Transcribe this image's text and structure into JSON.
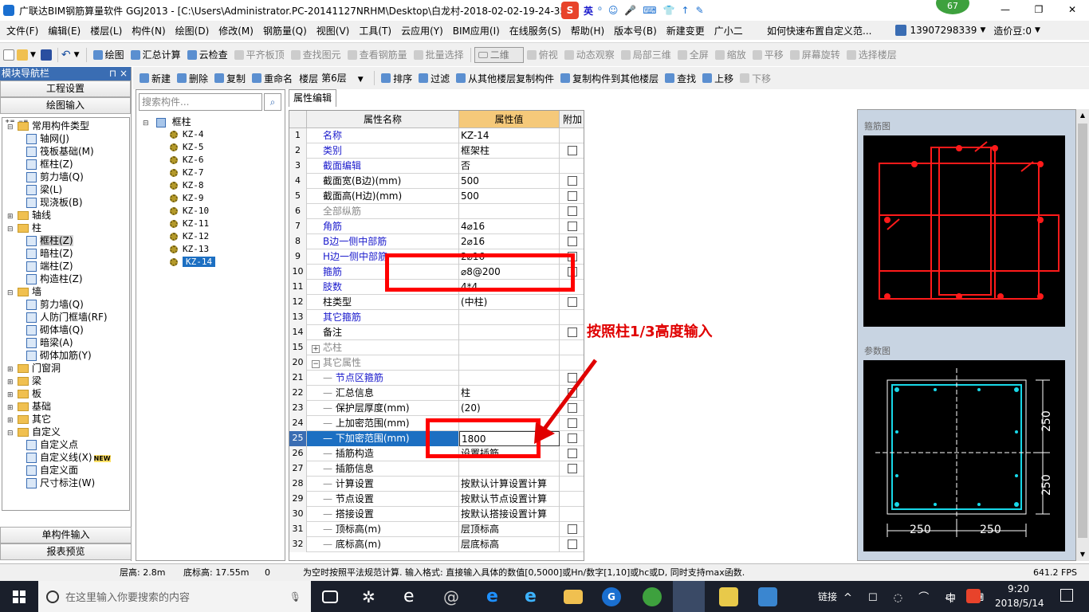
{
  "title": {
    "app": "广联达BIM钢筋算量软件 GGJ2013 - [C:\\Users\\Administrator.PC-20141127NRHM\\Desktop\\白龙村-2018-02-02-19-24-35",
    "ime": "英",
    "badge": "67",
    "controls": [
      "—",
      "❐",
      "✕"
    ]
  },
  "menu": {
    "items": [
      "文件(F)",
      "编辑(E)",
      "楼层(L)",
      "构件(N)",
      "绘图(D)",
      "修改(M)",
      "钢筋量(Q)",
      "视图(V)",
      "工具(T)",
      "云应用(Y)",
      "BIM应用(I)",
      "在线服务(S)",
      "帮助(H)",
      "版本号(B)",
      "新建变更",
      "广小二"
    ],
    "link": "如何快速布置自定义范...",
    "phone": "13907298339",
    "price": "造价豆:0"
  },
  "toolbar1": {
    "items": [
      "绘图",
      "汇总计算",
      "云检查",
      "平齐板顶",
      "查找图元",
      "查看钢筋量",
      "批量选择"
    ],
    "view_select": "二维",
    "items2": [
      "俯视",
      "动态观察",
      "局部三维",
      "全屏",
      "缩放",
      "平移",
      "屏幕旋转",
      "选择楼层"
    ]
  },
  "toolbar2": {
    "items": [
      "新建",
      "删除",
      "复制",
      "重命名"
    ],
    "floor_label": "楼层",
    "floor_value": "第6层",
    "items2": [
      "排序",
      "过滤",
      "从其他楼层复制构件",
      "复制构件到其他楼层",
      "查找",
      "上移",
      "下移"
    ]
  },
  "nav": {
    "title": "模块导航栏",
    "pin": "⊓ ×",
    "tabs": [
      "工程设置",
      "绘图输入"
    ],
    "bottom": [
      "单构件输入",
      "报表预览"
    ],
    "tree": [
      {
        "level": 0,
        "label": "常用构件类型",
        "type": "folder",
        "exp": "⊟"
      },
      {
        "level": 1,
        "label": "轴网(J)",
        "type": "leaf"
      },
      {
        "level": 1,
        "label": "筏板基础(M)",
        "type": "leaf"
      },
      {
        "level": 1,
        "label": "框柱(Z)",
        "type": "leaf"
      },
      {
        "level": 1,
        "label": "剪力墙(Q)",
        "type": "leaf"
      },
      {
        "level": 1,
        "label": "梁(L)",
        "type": "leaf"
      },
      {
        "level": 1,
        "label": "现浇板(B)",
        "type": "leaf"
      },
      {
        "level": 0,
        "label": "轴线",
        "type": "folder",
        "exp": "⊞"
      },
      {
        "level": 0,
        "label": "柱",
        "type": "folder",
        "exp": "⊟"
      },
      {
        "level": 1,
        "label": "框柱(Z)",
        "type": "leaf",
        "sel": true
      },
      {
        "level": 1,
        "label": "暗柱(Z)",
        "type": "leaf"
      },
      {
        "level": 1,
        "label": "端柱(Z)",
        "type": "leaf"
      },
      {
        "level": 1,
        "label": "构造柱(Z)",
        "type": "leaf"
      },
      {
        "level": 0,
        "label": "墙",
        "type": "folder",
        "exp": "⊟"
      },
      {
        "level": 1,
        "label": "剪力墙(Q)",
        "type": "leaf"
      },
      {
        "level": 1,
        "label": "人防门框墙(RF)",
        "type": "leaf"
      },
      {
        "level": 1,
        "label": "砌体墙(Q)",
        "type": "leaf"
      },
      {
        "level": 1,
        "label": "暗梁(A)",
        "type": "leaf"
      },
      {
        "level": 1,
        "label": "砌体加筋(Y)",
        "type": "leaf"
      },
      {
        "level": 0,
        "label": "门窗洞",
        "type": "folder",
        "exp": "⊞"
      },
      {
        "level": 0,
        "label": "梁",
        "type": "folder",
        "exp": "⊞"
      },
      {
        "level": 0,
        "label": "板",
        "type": "folder",
        "exp": "⊞"
      },
      {
        "level": 0,
        "label": "基础",
        "type": "folder",
        "exp": "⊞"
      },
      {
        "level": 0,
        "label": "其它",
        "type": "folder",
        "exp": "⊞"
      },
      {
        "level": 0,
        "label": "自定义",
        "type": "folder",
        "exp": "⊟"
      },
      {
        "level": 1,
        "label": "自定义点",
        "type": "leaf"
      },
      {
        "level": 1,
        "label": "自定义线(X)",
        "type": "leaf",
        "badge": "NEW"
      },
      {
        "level": 1,
        "label": "自定义面",
        "type": "leaf"
      },
      {
        "level": 1,
        "label": "尺寸标注(W)",
        "type": "leaf"
      }
    ]
  },
  "components": {
    "search_placeholder": "搜索构件...",
    "root": "框柱",
    "items": [
      "KZ-4",
      "KZ-5",
      "KZ-6",
      "KZ-7",
      "KZ-8",
      "KZ-9",
      "KZ-10",
      "KZ-11",
      "KZ-12",
      "KZ-13",
      "KZ-14"
    ],
    "selected": "KZ-14"
  },
  "props": {
    "tab": "属性编辑",
    "headers": [
      "属性名称",
      "属性值",
      "附加"
    ],
    "rows": [
      {
        "n": "1",
        "name": "名称",
        "value": "KZ-14",
        "cb": false,
        "style": "blue"
      },
      {
        "n": "2",
        "name": "类别",
        "value": "框架柱",
        "cb": true,
        "style": "blue"
      },
      {
        "n": "3",
        "name": "截面编辑",
        "value": "否",
        "cb": false,
        "style": "blue"
      },
      {
        "n": "4",
        "name": "截面宽(B边)(mm)",
        "value": "500",
        "cb": true,
        "style": ""
      },
      {
        "n": "5",
        "name": "截面高(H边)(mm)",
        "value": "500",
        "cb": true,
        "style": ""
      },
      {
        "n": "6",
        "name": "全部纵筋",
        "value": "",
        "cb": true,
        "style": "grey"
      },
      {
        "n": "7",
        "name": "角筋",
        "value": "4⌀16",
        "cb": true,
        "style": "blue"
      },
      {
        "n": "8",
        "name": "B边一侧中部筋",
        "value": "2⌀16",
        "cb": true,
        "style": "blue"
      },
      {
        "n": "9",
        "name": "H边一侧中部筋",
        "value": "2⌀16",
        "cb": true,
        "style": "blue"
      },
      {
        "n": "10",
        "name": "箍筋",
        "value": "⌀8@200",
        "cb": true,
        "style": "blue"
      },
      {
        "n": "11",
        "name": "肢数",
        "value": "4*4",
        "cb": false,
        "style": "blue"
      },
      {
        "n": "12",
        "name": "柱类型",
        "value": "(中柱)",
        "cb": true,
        "style": ""
      },
      {
        "n": "13",
        "name": "其它箍筋",
        "value": "",
        "cb": false,
        "style": "blue"
      },
      {
        "n": "14",
        "name": "备注",
        "value": "",
        "cb": true,
        "style": ""
      },
      {
        "n": "15",
        "name": "芯柱",
        "value": "",
        "cb": false,
        "style": "grey",
        "exp": "+"
      },
      {
        "n": "20",
        "name": "其它属性",
        "value": "",
        "cb": false,
        "style": "grey",
        "exp": "−"
      },
      {
        "n": "21",
        "name": "节点区箍筋",
        "value": "",
        "cb": true,
        "style": "blue",
        "child": true
      },
      {
        "n": "22",
        "name": "汇总信息",
        "value": "柱",
        "cb": true,
        "style": "",
        "child": true
      },
      {
        "n": "23",
        "name": "保护层厚度(mm)",
        "value": "(20)",
        "cb": true,
        "style": "",
        "child": true
      },
      {
        "n": "24",
        "name": "上加密范围(mm)",
        "value": "",
        "cb": true,
        "style": "",
        "child": true
      },
      {
        "n": "25",
        "name": "下加密范围(mm)",
        "value": "1800",
        "cb": true,
        "style": "",
        "child": true,
        "sel": true
      },
      {
        "n": "26",
        "name": "插筋构造",
        "value": "设置插筋",
        "cb": true,
        "style": "",
        "child": true
      },
      {
        "n": "27",
        "name": "插筋信息",
        "value": "",
        "cb": true,
        "style": "",
        "child": true
      },
      {
        "n": "28",
        "name": "计算设置",
        "value": "按默认计算设置计算",
        "cb": false,
        "style": "",
        "child": true
      },
      {
        "n": "29",
        "name": "节点设置",
        "value": "按默认节点设置计算",
        "cb": false,
        "style": "",
        "child": true
      },
      {
        "n": "30",
        "name": "搭接设置",
        "value": "按默认搭接设置计算",
        "cb": false,
        "style": "",
        "child": true
      },
      {
        "n": "31",
        "name": "顶标高(m)",
        "value": "层顶标高",
        "cb": true,
        "style": "",
        "child": true
      },
      {
        "n": "32",
        "name": "底标高(m)",
        "value": "层底标高",
        "cb": true,
        "style": "",
        "child": true
      }
    ]
  },
  "annotation": "按照柱1/3高度输入",
  "rightpanel": {
    "stirrup_title": "箍筋图",
    "param_title": "参数图",
    "dim_h_left": "250",
    "dim_h_right": "250",
    "dim_v_top": "250",
    "dim_v_bottom": "250"
  },
  "status": {
    "floor_height": "层高: 2.8m",
    "bottom_elev": "底标高: 17.55m",
    "zero": "0",
    "hint": "为空时按照平法规范计算. 输入格式: 直接输入具体的数值[0,5000]或Hn/数字[1,10]或hc或D, 同时支持max函数.",
    "fps": "641.2 FPS"
  },
  "taskbar": {
    "search_placeholder": "在这里输入你要搜索的内容",
    "link": "链接",
    "lang": "中",
    "time": "9:20",
    "date": "2018/5/14"
  },
  "colors": {
    "accent": "#3a6db3",
    "highlight": "#ff0000",
    "header_val": "#f5c97a"
  }
}
